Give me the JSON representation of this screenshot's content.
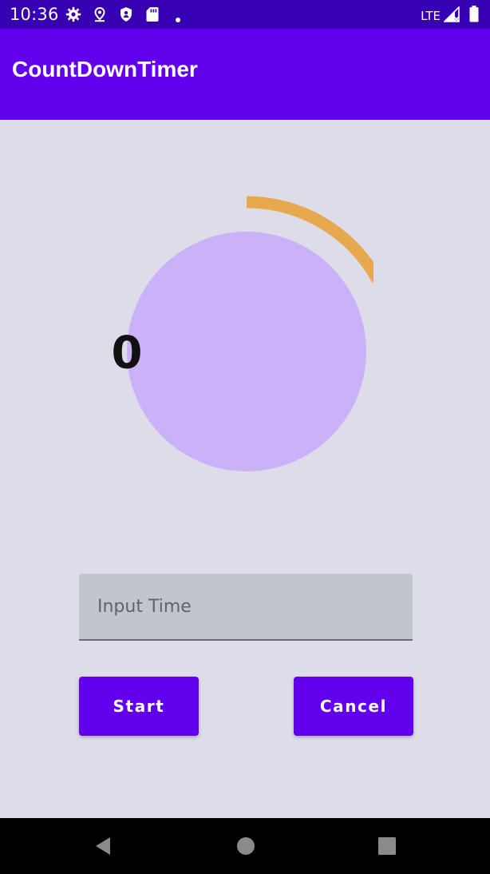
{
  "status_bar": {
    "time": "10:36",
    "network": "LTE",
    "icons": [
      "gear-icon",
      "location-icon",
      "shield-icon",
      "sd-card-icon",
      "dot-icon",
      "signal-icon",
      "battery-icon"
    ]
  },
  "app_bar": {
    "title": "CountDownTimer"
  },
  "timer": {
    "value": "0",
    "progress_fraction": 0.17,
    "arc_color": "#e8a94e",
    "circle_color": "#cbb1f7"
  },
  "input": {
    "value": "",
    "placeholder": "Input Time"
  },
  "buttons": {
    "start_label": "Start",
    "cancel_label": "Cancel"
  },
  "navigation": {
    "icons": [
      "back-icon",
      "home-icon",
      "recents-icon"
    ]
  },
  "colors": {
    "status_bar": "#3700b3",
    "app_bar": "#6200ee",
    "background": "#dcdde9",
    "button": "#6200ee"
  }
}
